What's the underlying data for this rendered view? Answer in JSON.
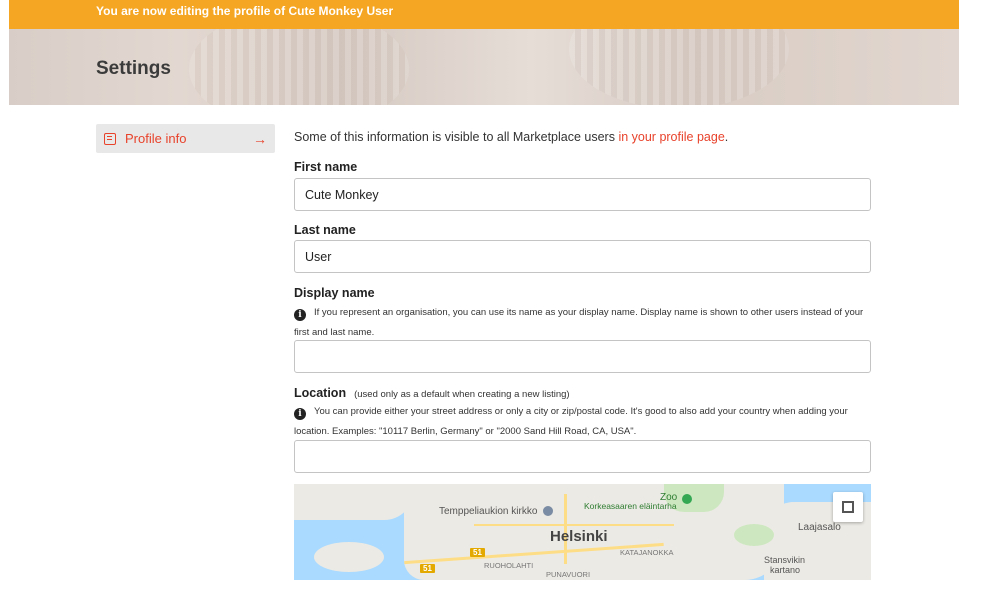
{
  "banner": {
    "text": "You are now editing the profile of Cute Monkey User"
  },
  "header": {
    "title": "Settings"
  },
  "sidebar": {
    "items": [
      {
        "label": "Profile info",
        "icon": "profile-card-icon",
        "arrow": "→"
      }
    ]
  },
  "form": {
    "intro_text": "Some of this information is visible to all Marketplace users ",
    "intro_link": "in your profile page",
    "intro_end": ".",
    "first_name": {
      "label": "First name",
      "value": "Cute Monkey"
    },
    "last_name": {
      "label": "Last name",
      "value": "User"
    },
    "display_name": {
      "label": "Display name",
      "help": "If you represent an organisation, you can use its name as your display name. Display name is shown to other users instead of your first and last name.",
      "value": ""
    },
    "location": {
      "label": "Location",
      "note": "(used only as a default when creating a new listing)",
      "help": "You can provide either your street address or only a city or zip/postal code. It's good to also add your country when adding your location. Examples: \"10117 Berlin, Germany\" or \"2000 Sand Hill Road, CA, USA\".",
      "value": ""
    }
  },
  "map": {
    "labels": {
      "city": "Helsinki",
      "church": "Temppeliaukion kirkko",
      "zoo": "Zoo",
      "zoo_sub": "Korkeasaaren eläintarha",
      "laajasalo": "Laajasalo",
      "katajanokka": "KATAJANOKKA",
      "ruoholahti": "RUOHOLAHTI",
      "punavuori": "PUNAVUORI",
      "stansvikin": "Stansvikin",
      "kartano": "kartano",
      "road_51a": "51",
      "road_51b": "51"
    },
    "colors": {
      "water": "#aadaff",
      "land": "#eceae4",
      "park": "#cde8c0",
      "road": "#fddd86"
    }
  },
  "colors": {
    "banner": "#f5a623",
    "accent": "#e8422b"
  }
}
